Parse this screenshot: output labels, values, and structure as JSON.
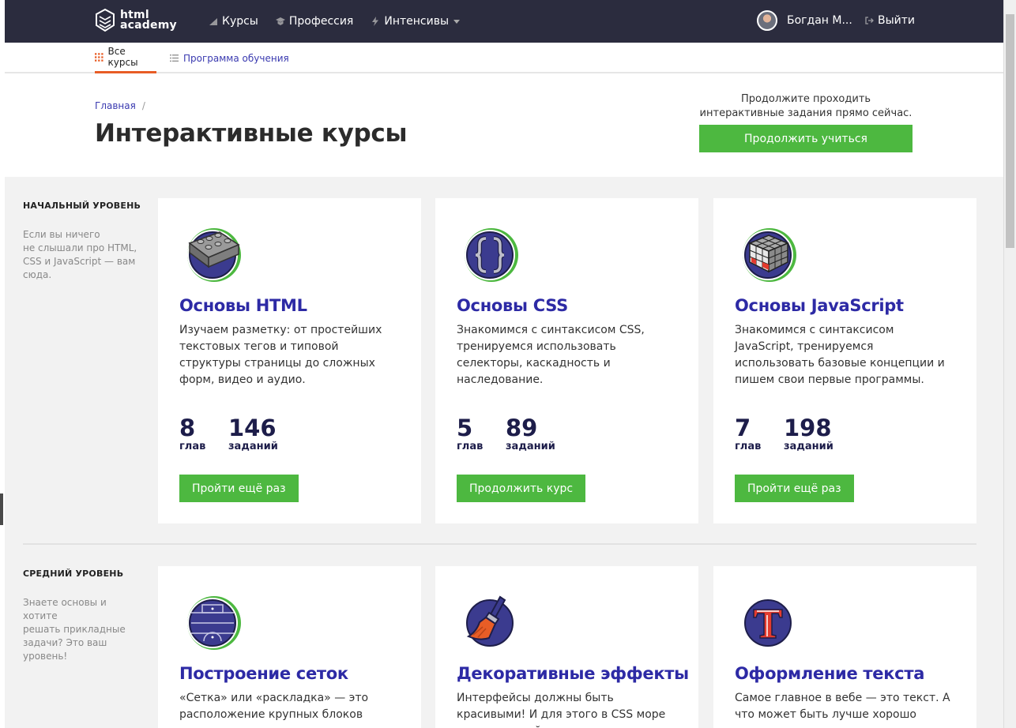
{
  "topbar": {
    "logo_line1": "html",
    "logo_line2": "academy",
    "nav": [
      {
        "label": "Курсы",
        "icon": "chart-icon"
      },
      {
        "label": "Профессия",
        "icon": "graduation-cap-icon"
      },
      {
        "label": "Интенсивы",
        "icon": "lightning-icon"
      }
    ],
    "user_name": "Богдан М...",
    "logout_label": "Выйти"
  },
  "subnav": {
    "all_courses": "Все курсы",
    "program": "Программа обучения"
  },
  "header": {
    "breadcrumb_home": "Главная",
    "breadcrumb_sep": "/",
    "title": "Интерактивные курсы",
    "cta_text_line1": "Продолжите проходить",
    "cta_text_line2": "интерактивные задания прямо сейчас.",
    "cta_button": "Продолжить учиться"
  },
  "levels": [
    {
      "title": "НАЧАЛЬНЫЙ УРОВЕНЬ",
      "desc_lines": [
        "Если вы ничего",
        "не слышали про HTML,",
        "CSS и JavaScript — вам",
        "сюда."
      ],
      "courses": [
        {
          "title": "Основы HTML",
          "desc": "Изучаем разметку: от простейших текстовых тегов и типовой структуры страницы до сложных форм, видео и аудио.",
          "chapters": "8",
          "chapters_label": "глав",
          "tasks": "146",
          "tasks_label": "заданий",
          "button": "Пройти ещё раз",
          "icon": "lego-brick-icon"
        },
        {
          "title": "Основы CSS",
          "desc": "Знакомимся с синтаксисом CSS, тренируемся использовать селекторы, каскадность и наследование.",
          "chapters": "5",
          "chapters_label": "глав",
          "tasks": "89",
          "tasks_label": "заданий",
          "button": "Продолжить курс",
          "icon": "curly-braces-icon"
        },
        {
          "title": "Основы JavaScript",
          "desc": "Знакомимся с синтаксисом JavaScript, тренируемся использовать базовые концепции и пишем свои первые программы.",
          "chapters": "7",
          "chapters_label": "глав",
          "tasks": "198",
          "tasks_label": "заданий",
          "button": "Пройти ещё раз",
          "icon": "rubiks-cube-icon"
        }
      ]
    },
    {
      "title": "СРЕДНИЙ УРОВЕНЬ",
      "desc_lines": [
        "Знаете основы и хотите",
        "решать прикладные",
        "задачи? Это ваш",
        "уровень!"
      ],
      "courses": [
        {
          "title": "Построение сеток",
          "desc": "«Сетка» или «раскладка» — это расположение крупных блоков",
          "icon": "football-field-icon"
        },
        {
          "title": "Декоративные эффекты",
          "desc": "Интерфейсы должны быть красивыми! И для этого в CSS море возможностей.",
          "icon": "paint-brush-icon"
        },
        {
          "title": "Оформление текста",
          "desc": "Самое главное в вебе — это текст. А что может быть лучше хорошо",
          "icon": "letter-t-icon"
        }
      ]
    }
  ],
  "colors": {
    "topbar": "#2b2c3e",
    "accent_green": "#4db840",
    "title_blue": "#2d2aa5",
    "tab_underline": "#e85d26"
  }
}
